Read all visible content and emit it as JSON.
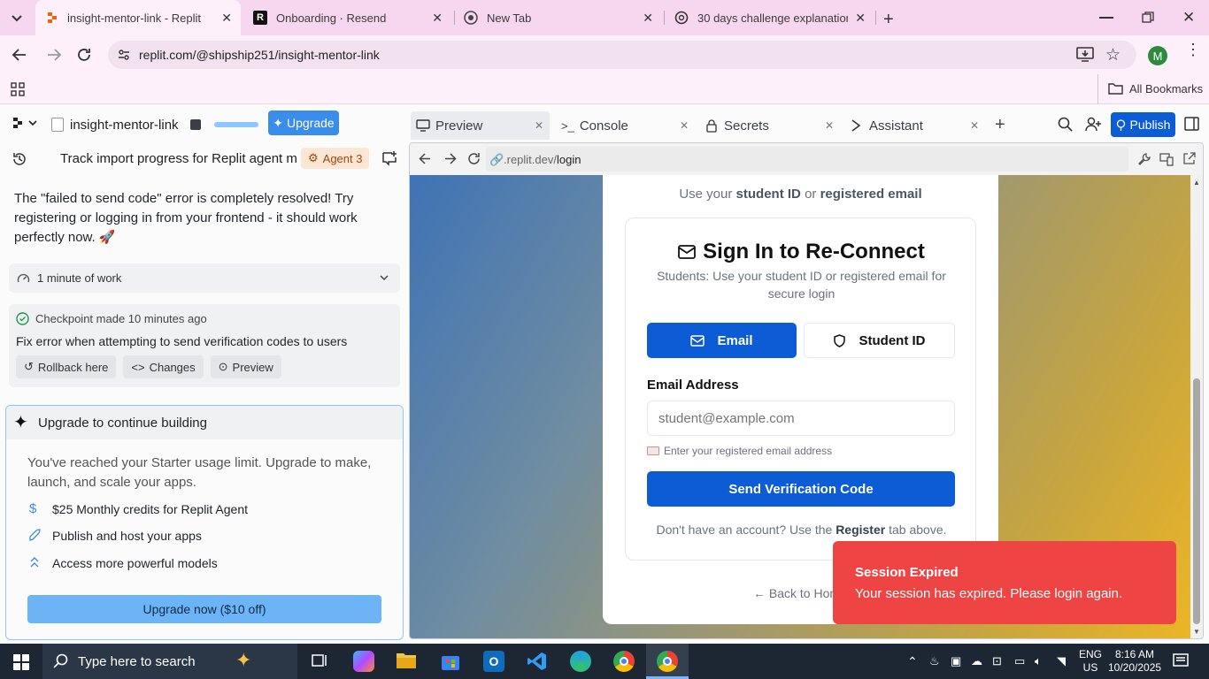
{
  "browser": {
    "tabs": [
      {
        "title": "insight-mentor-link - Replit",
        "active": true
      },
      {
        "title": "Onboarding · Resend",
        "active": false
      },
      {
        "title": "New Tab",
        "active": false
      },
      {
        "title": "30 days challenge explanation",
        "active": false
      }
    ],
    "url": "replit.com/@shipship251/insight-mentor-link",
    "profile_initial": "M",
    "bookmarks_label": "All Bookmarks"
  },
  "replit": {
    "project_name": "insight-mentor-link",
    "upgrade_label": "Upgrade",
    "thread_title": "Track import progress for Replit agent mi...",
    "agent_badge": "Agent 3",
    "message": "The \"failed to send code\" error is completely resolved! Try registering or logging in from your frontend - it should work perfectly now. 🚀",
    "work_summary": "1 minute of work",
    "checkpoint": {
      "label": "Checkpoint made",
      "time": "10 minutes ago",
      "title": "Fix error when attempting to send verification codes to users",
      "actions": [
        "Rollback here",
        "Changes",
        "Preview"
      ]
    },
    "upgrade_card": {
      "title": "Upgrade to continue building",
      "description": "You've reached your Starter usage limit. Upgrade to make, launch, and scale your apps.",
      "features": [
        "$25 Monthly credits for Replit Agent",
        "Publish and host your apps",
        "Access more powerful models"
      ],
      "cta": "Upgrade now ($10 off)"
    },
    "panel_tabs": [
      "Preview",
      "Console",
      "Secrets",
      "Assistant"
    ],
    "publish_label": "Publish",
    "preview_url_prefix": ".replit.dev/",
    "preview_url_path": "login"
  },
  "site": {
    "hint_prefix": "Use your",
    "hint_student_id": "student ID",
    "hint_or": "or",
    "hint_email": "registered email",
    "title": "Sign In to Re-Connect",
    "subtitle": "Students: Use your student ID or registered email for secure login",
    "tab_email": "Email",
    "tab_student_id": "Student ID",
    "email_label": "Email Address",
    "email_placeholder": "student@example.com",
    "email_help": "Enter your registered email address",
    "submit": "Send Verification Code",
    "register_prefix": "Don't have an account? Use the",
    "register_link": "Register",
    "register_suffix": "tab above.",
    "back_link": "← Back to Home"
  },
  "toast": {
    "title": "Session Expired",
    "message": "Your session has expired. Please login again."
  },
  "taskbar": {
    "search_placeholder": "Type here to search",
    "lang_top": "ENG",
    "lang_bottom": "US",
    "time": "8:16 AM",
    "date": "10/20/2025"
  },
  "colors": {
    "accent_blue": "#0b5cd5",
    "replit_upgrade": "#3a8de8",
    "toast_red": "#ef4444",
    "upgrade_cta": "#6db4f7"
  }
}
